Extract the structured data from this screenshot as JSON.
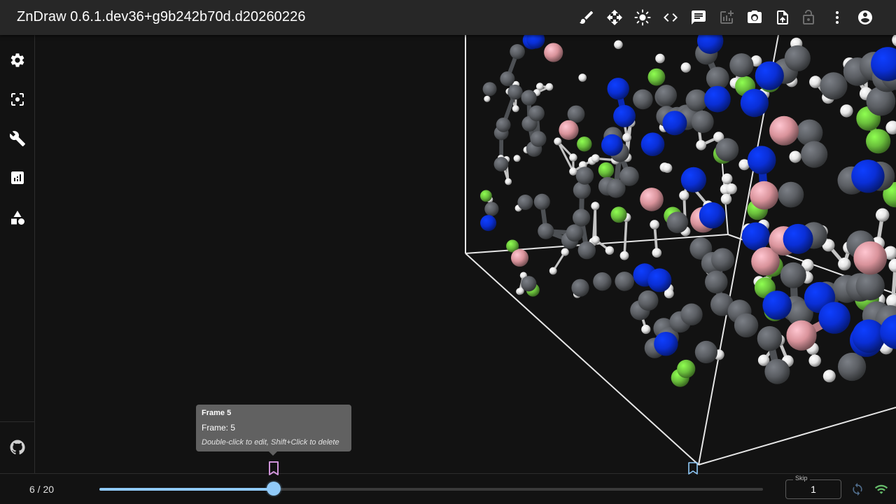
{
  "app": {
    "title": "ZnDraw 0.6.1.dev36+g9b242b70d.d20260226"
  },
  "toolbar": {
    "icons": [
      "brush-icon",
      "move-icon",
      "brightness-icon",
      "code-icon",
      "chat-icon",
      "add-chart-icon",
      "camera-icon",
      "upload-file-icon",
      "lock-icon",
      "more-vert-icon",
      "account-icon"
    ],
    "disabled": [
      "add-chart-icon",
      "lock-icon"
    ]
  },
  "sidebar": {
    "items": [
      "settings-icon",
      "center-focus-icon",
      "build-icon",
      "analytics-icon",
      "geometry-shapes-icon"
    ],
    "footer": "github-icon"
  },
  "player": {
    "frame_counter": "6 / 20",
    "current_frame": 6,
    "total_frames": 20,
    "progress": 0.263,
    "skip_label": "Skip",
    "skip_value": "1"
  },
  "tooltip": {
    "title": "Frame 5",
    "frame_line": "Frame: 5",
    "hint": "Double-click to edit, Shift+Click to delete"
  },
  "colors": {
    "accent": "#90caf9",
    "bookmark_active": "#ce93d8",
    "bookmark_idle": "#90caf9",
    "carbon": "#5b5e63",
    "hydrogen": "#e6e6e6",
    "nitrogen": "#0a2fd6",
    "fluorine": "#6abf3c",
    "boron": "#d9939b",
    "connection": "#66bb6a"
  }
}
